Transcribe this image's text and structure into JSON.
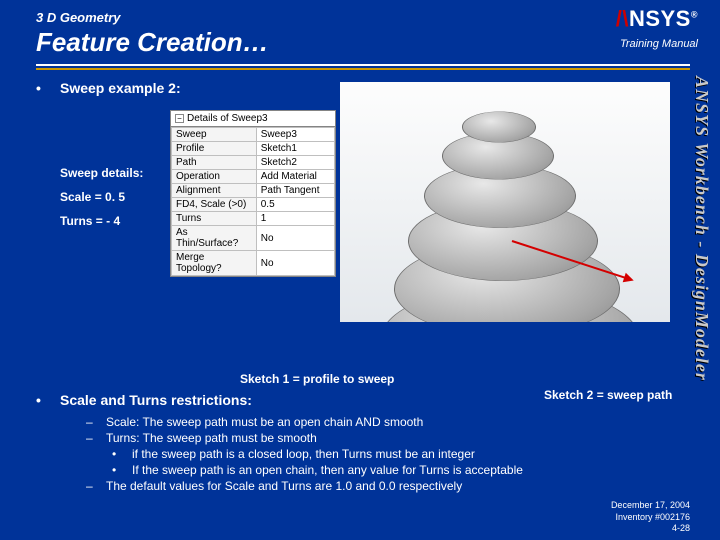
{
  "header": {
    "geom": "3 D Geometry",
    "title": "Feature Creation…",
    "logo_a": "/\\NSYS",
    "training": "Training Manual"
  },
  "side_text": "ANSYS Workbench - DesignModeler",
  "bullet1": "Sweep example 2:",
  "sweep": {
    "label": "Sweep details:",
    "scale": "Scale = 0. 5",
    "turns": "Turns = - 4"
  },
  "details": {
    "heading": "Details of Sweep3",
    "rows": [
      {
        "k": "Sweep",
        "v": "Sweep3"
      },
      {
        "k": "Profile",
        "v": "Sketch1"
      },
      {
        "k": "Path",
        "v": "Sketch2"
      },
      {
        "k": "Operation",
        "v": "Add Material"
      },
      {
        "k": "Alignment",
        "v": "Path Tangent"
      },
      {
        "k": "FD4, Scale (>0)",
        "v": "0.5"
      },
      {
        "k": "Turns",
        "v": "1"
      },
      {
        "k": "As Thin/Surface?",
        "v": "No"
      },
      {
        "k": "Merge Topology?",
        "v": "No"
      }
    ]
  },
  "labels": {
    "sketch1": "Sketch 1 = profile to sweep",
    "sketch2": "Sketch 2 = sweep path"
  },
  "restrict": {
    "title": "Scale and Turns restrictions:",
    "lines": [
      "Scale: The sweep path must be an open chain AND smooth",
      "Turns: The sweep path must be smooth"
    ],
    "sub": [
      "if the sweep path is a closed loop, then Turns must be an integer",
      "If the sweep path is an open chain, then any value for Turns is acceptable"
    ],
    "last": "The default values for Scale and Turns are 1.0 and 0.0 respectively"
  },
  "footer": {
    "date": "December 17, 2004",
    "inv": "Inventory #002176",
    "page": "4-28"
  }
}
